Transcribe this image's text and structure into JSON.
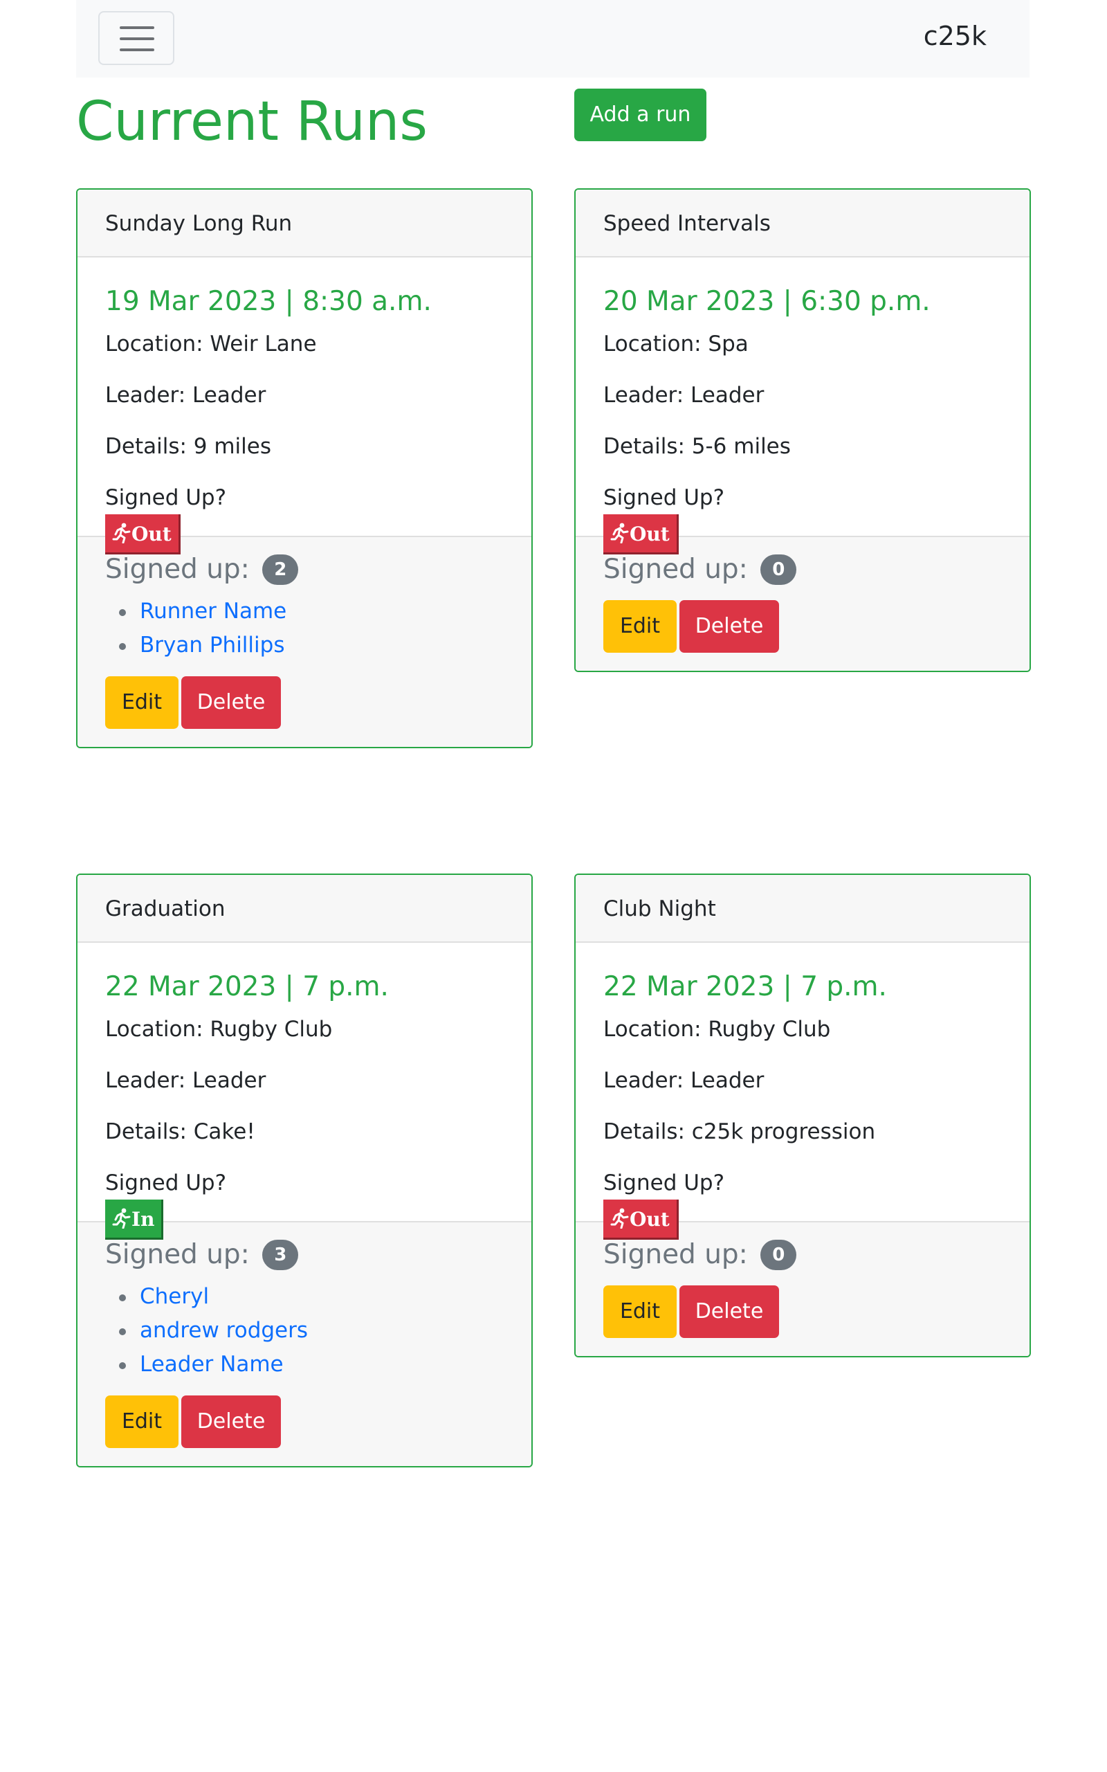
{
  "navbar": {
    "brand": "c25k",
    "toggler_icon": "hamburger-icon"
  },
  "page": {
    "title": "Current Runs",
    "add_button": "Add a run"
  },
  "labels": {
    "signed_up_question": "Signed Up?",
    "signed_up_count": "Signed up:",
    "edit": "Edit",
    "delete": "Delete"
  },
  "runs": [
    {
      "name": "Sunday Long Run",
      "when": "19 Mar 2023 | 8:30 a.m.",
      "location": "Location: Weir Lane",
      "leader": "Leader: Leader",
      "details": "Details: 9 miles",
      "status": "Out",
      "status_icon": "runner-icon",
      "status_color": "#dc3545",
      "count": "2",
      "runners": [
        "Runner Name",
        "Bryan Phillips"
      ]
    },
    {
      "name": "Speed Intervals",
      "when": "20 Mar 2023 | 6:30 p.m.",
      "location": "Location: Spa",
      "leader": "Leader: Leader",
      "details": "Details: 5-6 miles",
      "status": "Out",
      "status_icon": "runner-icon",
      "status_color": "#dc3545",
      "count": "0",
      "runners": []
    },
    {
      "name": "Graduation",
      "when": "22 Mar 2023 | 7 p.m.",
      "location": "Location: Rugby Club",
      "leader": "Leader: Leader",
      "details": "Details: Cake!",
      "status": "In",
      "status_icon": "runner-icon",
      "status_color": "#28a745",
      "count": "3",
      "runners": [
        "Cheryl",
        "andrew rodgers",
        "Leader Name"
      ]
    },
    {
      "name": "Club Night",
      "when": "22 Mar 2023 | 7 p.m.",
      "location": "Location: Rugby Club",
      "leader": "Leader: Leader",
      "details": "Details: c25k progression",
      "status": "Out",
      "status_icon": "runner-icon",
      "status_color": "#dc3545",
      "count": "0",
      "runners": []
    }
  ],
  "colors": {
    "accent": "#28a745",
    "danger": "#dc3545",
    "warning": "#ffc107",
    "link": "#0d6efd",
    "badge": "#6c757d"
  }
}
